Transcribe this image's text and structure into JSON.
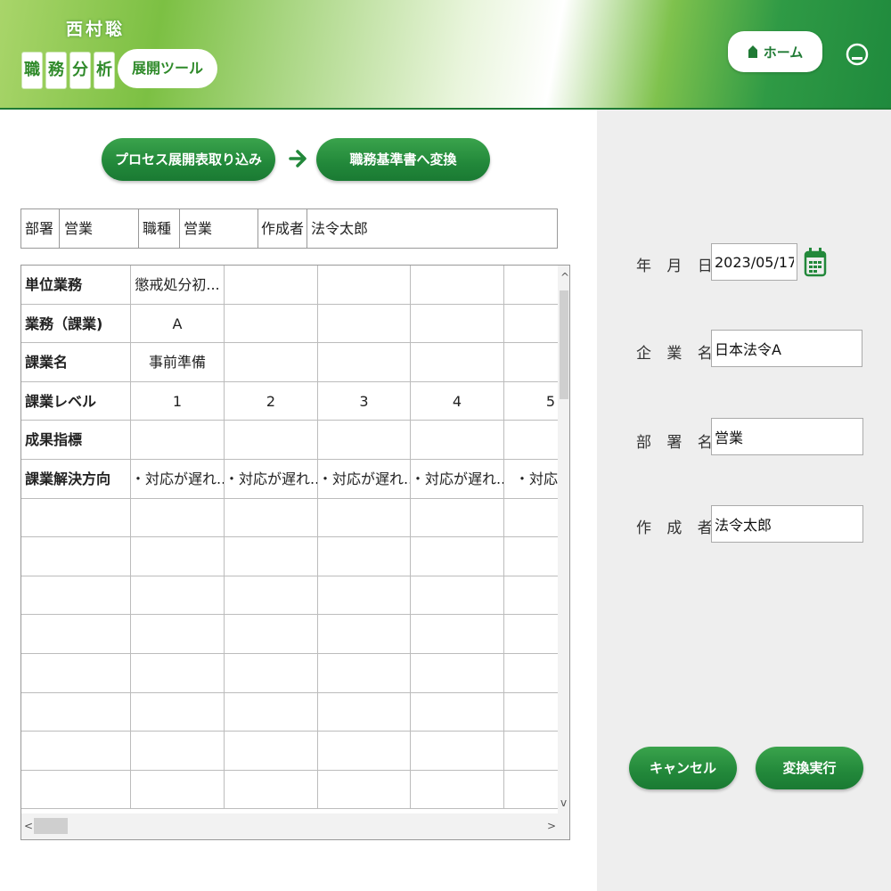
{
  "header": {
    "author": "西村聡",
    "title_chars": [
      "職",
      "務",
      "分",
      "析"
    ],
    "tool_label": "展開ツール",
    "home_label": "ホーム",
    "home_icon": "house-icon",
    "logout_icon": "logout-icon"
  },
  "actions": {
    "import_label": "プロセス展開表取り込み",
    "convert_label": "職務基準書へ変換",
    "arrow_icon": "arrow-right-icon"
  },
  "info": {
    "dept_label": "部署",
    "dept_value": "営業",
    "job_label": "職種",
    "job_value": "営業",
    "author_label": "作成者",
    "author_value": "法令太郎"
  },
  "grid": {
    "row_headers": [
      "単位業務",
      "業務（課業)",
      "課業名",
      "課業レベル",
      "成果指標",
      "課業解決方向"
    ],
    "rows": [
      [
        "懲戒処分初...",
        "",
        "",
        "",
        ""
      ],
      [
        "A",
        "",
        "",
        "",
        ""
      ],
      [
        "事前準備",
        "",
        "",
        "",
        ""
      ],
      [
        "1",
        "2",
        "3",
        "4",
        "5"
      ],
      [
        "",
        "",
        "",
        "",
        ""
      ],
      [
        "・対応が遅れ...",
        "・対応が遅れ...",
        "・対応が遅れ...",
        "・対応が遅れ...",
        "・対応が遅"
      ]
    ],
    "empty_rows": 8
  },
  "form": {
    "date_label": "年 月 日:",
    "date_value": "2023/05/17",
    "company_label": "企 業 名:",
    "company_value": "日本法令A",
    "dept_label": "部 署 名:",
    "dept_value": "営業",
    "creator_label": "作 成 者:",
    "creator_value": "法令太郎",
    "calendar_icon": "calendar-icon"
  },
  "buttons": {
    "cancel_label": "キャンセル",
    "execute_label": "変換実行"
  },
  "colors": {
    "brand_green": "#22883a",
    "panel_gray": "#eeeeee"
  }
}
